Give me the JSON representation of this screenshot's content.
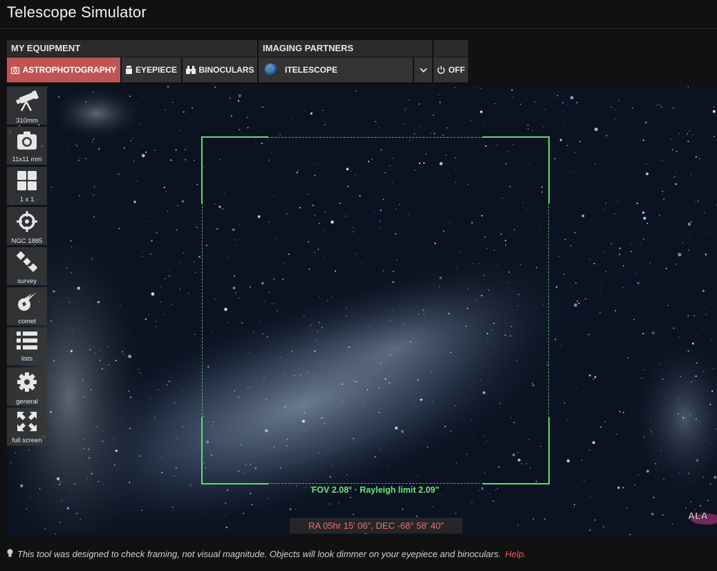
{
  "app": {
    "title": "Telescope Simulator"
  },
  "toolbar": {
    "my_equipment_label": "MY EQUIPMENT",
    "imaging_partners_label": "IMAGING PARTNERS",
    "modes": [
      {
        "label": "ASTROPHOTOGRAPHY",
        "icon": "camera-icon",
        "active": true
      },
      {
        "label": "EYEPIECE",
        "icon": "eyepiece-icon",
        "active": false
      },
      {
        "label": "BINOCULARS",
        "icon": "binoculars-icon",
        "active": false
      }
    ],
    "partner": {
      "label": "ITELESCOPE",
      "icon": "globe-icon"
    },
    "power": {
      "label": "OFF",
      "icon": "power-icon"
    }
  },
  "side_tools": [
    {
      "label": "310mm",
      "icon": "telescope-icon"
    },
    {
      "label": "11x11 mm",
      "icon": "camera-icon"
    },
    {
      "label": "1 x 1",
      "icon": "grid-icon"
    },
    {
      "label": "NGC 1885",
      "icon": "crosshair-icon"
    },
    {
      "label": "survey",
      "icon": "satellite-icon"
    },
    {
      "label": "comet",
      "icon": "comet-icon"
    },
    {
      "label": "lists",
      "icon": "list-icon"
    },
    {
      "label": "general",
      "icon": "gear-icon"
    },
    {
      "label": "full screen",
      "icon": "expand-icon"
    }
  ],
  "viewer": {
    "fov_label": "FOV 2.08° · Rayleigh limit 2.09\"",
    "coordinates": "RA 05hr 15' 06\", DEC -68° 58' 40\"",
    "fov_color": "#5fe06a",
    "coord_color": "#f07070"
  },
  "footer": {
    "note": "This tool was designed to check framing, not visual magnitude. Objects will look dimmer on your eyepiece and binoculars.",
    "help_link": "Help."
  },
  "colors": {
    "accent": "#c05454",
    "toolbar_bg": "#333333",
    "page_bg": "#111111"
  }
}
